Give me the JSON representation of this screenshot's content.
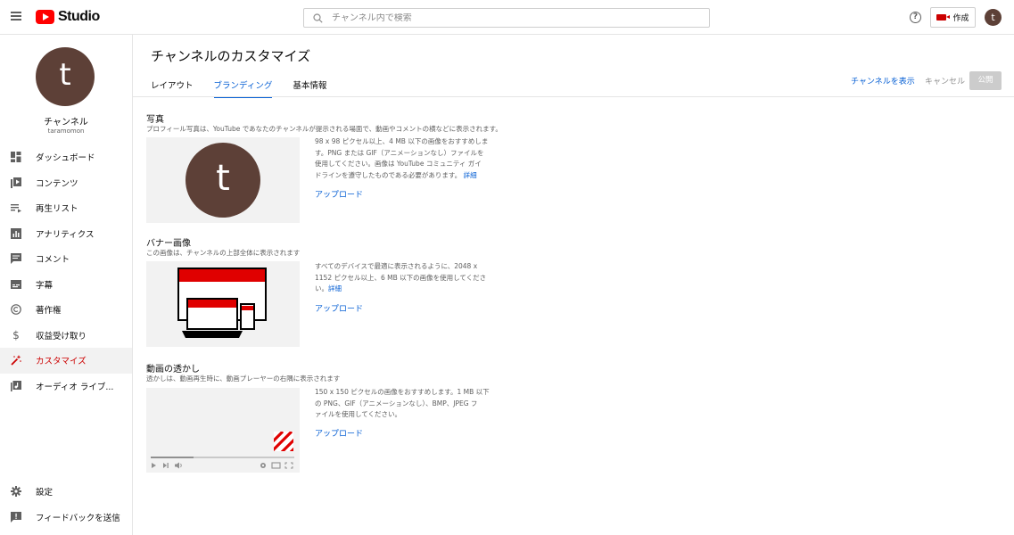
{
  "header": {
    "logo_text": "Studio",
    "search_placeholder": "チャンネル内で検索",
    "help_glyph": "?",
    "create_label": "作成",
    "avatar_letter": "t"
  },
  "sidebar": {
    "avatar_letter": "t",
    "channel_name": "チャンネル",
    "channel_handle": "taramomon",
    "items": [
      {
        "label": "ダッシュボード",
        "icon": "dashboard-icon"
      },
      {
        "label": "コンテンツ",
        "icon": "content-icon"
      },
      {
        "label": "再生リスト",
        "icon": "playlist-icon"
      },
      {
        "label": "アナリティクス",
        "icon": "analytics-icon"
      },
      {
        "label": "コメント",
        "icon": "comment-icon"
      },
      {
        "label": "字幕",
        "icon": "subtitles-icon"
      },
      {
        "label": "著作権",
        "icon": "copyright-icon"
      },
      {
        "label": "収益受け取り",
        "icon": "dollar-icon"
      },
      {
        "label": "カスタマイズ",
        "icon": "magic-wand-icon",
        "active": true
      },
      {
        "label": "オーディオ ライブ...",
        "icon": "audio-library-icon"
      }
    ],
    "bottom_items": [
      {
        "label": "設定",
        "icon": "gear-icon"
      },
      {
        "label": "フィードバックを送信",
        "icon": "feedback-icon"
      }
    ]
  },
  "main": {
    "title": "チャンネルのカスタマイズ",
    "tabs": [
      {
        "label": "レイアウト"
      },
      {
        "label": "ブランディング",
        "active": true
      },
      {
        "label": "基本情報"
      }
    ],
    "actions": {
      "view_channel": "チャンネルを表示",
      "cancel": "キャンセル",
      "publish": "公開"
    },
    "photo": {
      "title": "写真",
      "description": "プロフィール写真は、YouTube であなたのチャンネルが提示される場面で、動画やコメントの横などに表示されます。",
      "avatar_letter": "t",
      "info_lines": [
        "98 x 98 ピクセル以上、4 MB 以下の画像をおすすめしま",
        "す。PNG または GIF（アニメーションなし）ファイルを",
        "使用してください。画像は YouTube コミュニティ ガイ",
        "ドラインを遵守したものである必要があります。"
      ],
      "detail_link": "詳細",
      "upload": "アップロード"
    },
    "banner": {
      "title": "バナー画像",
      "description": "この画像は、チャンネルの上部全体に表示されます",
      "info_lines": [
        "すべてのデバイスで最適に表示されるように、2048 x",
        "1152 ピクセル以上、6 MB 以下の画像を使用してくださ",
        "い。"
      ],
      "detail_link": "詳細",
      "upload": "アップロード"
    },
    "watermark": {
      "title": "動画の透かし",
      "description": "透かしは、動画再生時に、動画プレーヤーの右隅に表示されます",
      "info_lines": [
        "150 x 150 ピクセルの画像をおすすめします。1 MB 以下",
        "の PNG、GIF（アニメーションなし）、BMP、JPEG フ",
        "ァイルを使用してください。"
      ],
      "upload": "アップロード",
      "playback_progress_fraction": 0.3
    }
  },
  "colors": {
    "accent_blue": "#065fd4",
    "brand_red": "#cc0000",
    "avatar_brown": "#5d4037"
  }
}
